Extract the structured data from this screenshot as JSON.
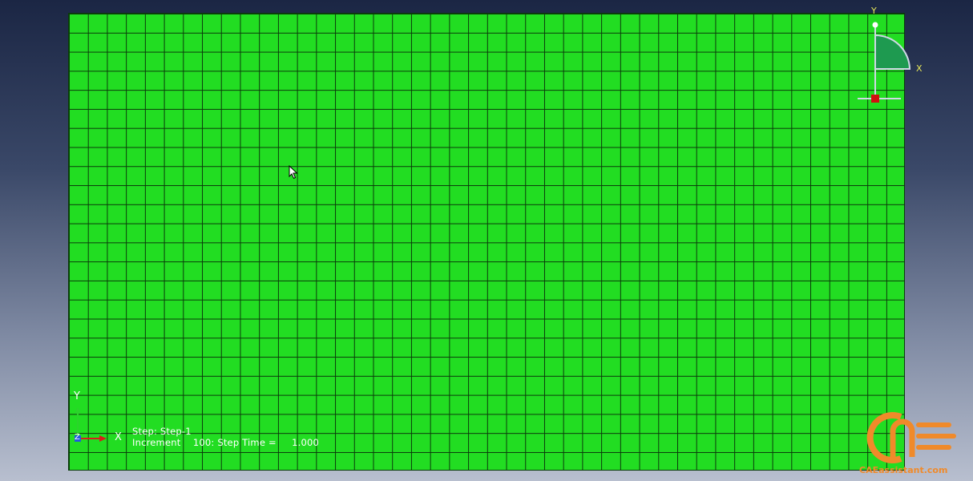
{
  "viewport": {
    "background_top": "#1b2644",
    "background_bottom": "#b8bfcf",
    "mesh_color": "#22dd22",
    "mesh_line_color": "#0b3a0b",
    "mesh_columns": 44,
    "mesh_rows": 24
  },
  "triad_top_right": {
    "y_label": "Y",
    "x_label": "X",
    "icon": "view-orientation-triad-icon"
  },
  "triad_bottom_left": {
    "y_label": "Y",
    "x_label": "X",
    "z_label": "Z",
    "icon": "coordinate-triad-icon"
  },
  "step_info": {
    "line1": "Step: Step-1",
    "line2": "Increment    100: Step Time =     1.000"
  },
  "watermark": {
    "text": "CAEassistant.com",
    "color": "#f08a2a",
    "icon": "caeassistant-logo-icon"
  },
  "cursor": {
    "icon": "mouse-pointer-icon"
  }
}
